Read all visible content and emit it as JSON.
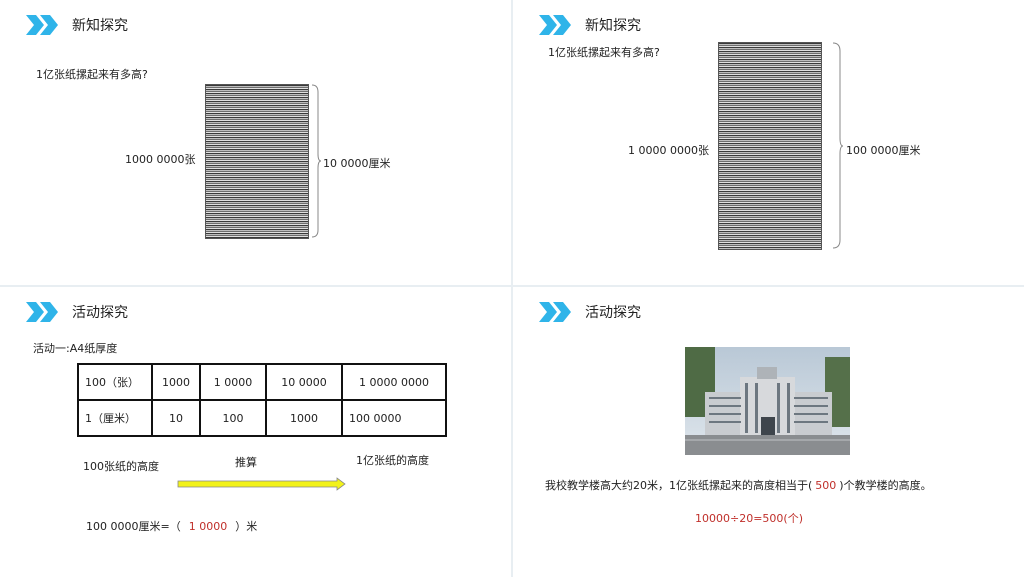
{
  "slide1": {
    "header": "新知探究",
    "question": "1亿张纸摞起来有多高?",
    "left_label": "1000 0000张",
    "right_label": "10 0000厘米"
  },
  "slide2": {
    "header": "新知探究",
    "question": "1亿张纸摞起来有多高?",
    "left_label": "1 0000 0000张",
    "right_label": "100 0000厘米"
  },
  "slide3": {
    "header": "活动探究",
    "activity": "活动一:A4纸厚度",
    "table": {
      "rows": [
        [
          "100（张）",
          "1000",
          "1 0000",
          "10 0000",
          "1 0000 0000"
        ],
        [
          "1（厘米）",
          "10",
          "100",
          "1000",
          "100 0000"
        ]
      ]
    },
    "from_label": "100张纸的高度",
    "arrow_label": "推算",
    "to_label": "1亿张纸的高度",
    "equation_prefix": "100 0000厘米=（",
    "equation_answer": "1 0000",
    "equation_suffix": "）米"
  },
  "slide4": {
    "header": "活动探究",
    "statement_prefix": "我校教学楼高大约20米，1亿张纸摞起来的高度相当于(",
    "statement_answer": "500",
    "statement_suffix": ")个教学楼的高度。",
    "calculation": "10000÷20=500(个)"
  },
  "colors": {
    "accent": "#2fb4e9",
    "answer": "#c0302b",
    "arrow_fill": "#f2f21a"
  }
}
